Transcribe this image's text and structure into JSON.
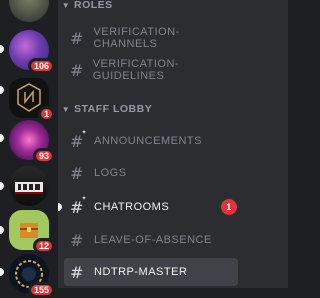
{
  "servers": [
    {
      "name": "server-1",
      "badge": ""
    },
    {
      "name": "server-2",
      "badge": "106"
    },
    {
      "name": "server-3",
      "badge": "1",
      "logo_text": "NOTRP"
    },
    {
      "name": "server-4",
      "badge": "93"
    },
    {
      "name": "server-5",
      "badge": "",
      "logo_text": "DEAD"
    },
    {
      "name": "server-6",
      "badge": "12"
    },
    {
      "name": "server-7",
      "badge": "155"
    }
  ],
  "categories": {
    "roles": "ROLES",
    "staff_lobby": "STAFF LOBBY"
  },
  "channels": {
    "verification_channels": "VERIFICATION-CHANNELS",
    "verification_guidelines": "VERIFICATION-GUIDELINES",
    "announcements": "ANNOUNCEMENTS",
    "logs": "LOGS",
    "chatrooms": "CHATROOMS",
    "chatrooms_badge": "1",
    "leave_of_absence": "LEAVE-OF-ABSENCE",
    "ndtrp_master": "NDTRP-MASTER"
  },
  "colors": {
    "rail_bg": "#1e1f22",
    "channel_bg": "#2b2d31",
    "active_bg": "#404249",
    "badge_red": "#da373c",
    "muted_text": "#80848e"
  }
}
